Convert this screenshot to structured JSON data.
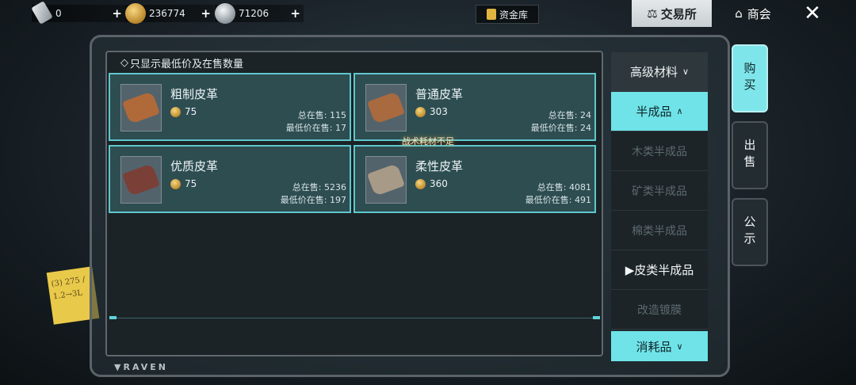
{
  "currencies": [
    {
      "name": "ticket",
      "value": "0"
    },
    {
      "name": "gold",
      "value": "236774"
    },
    {
      "name": "silver",
      "value": "71206"
    }
  ],
  "top": {
    "vault_label": "资金库",
    "exchange_label": "交易所",
    "shop_label": "商会"
  },
  "filter_label": "只显示最低价及在售数量",
  "items": [
    {
      "name": "粗制皮革",
      "price": "75",
      "on_sale": "总在售: 115",
      "lowest": "最低价在售: 17",
      "color": "#b06a3a"
    },
    {
      "name": "普通皮革",
      "price": "303",
      "on_sale": "总在售: 24",
      "lowest": "最低价在售: 24",
      "color": "#a86a3e"
    },
    {
      "name": "优质皮革",
      "price": "75",
      "on_sale": "总在售: 5236",
      "lowest": "最低价在售: 197",
      "color": "#7a4038"
    },
    {
      "name": "柔性皮革",
      "price": "360",
      "on_sale": "总在售: 4081",
      "lowest": "最低价在售: 491",
      "color": "#a79a86"
    }
  ],
  "warning": "战术耗材不足",
  "categories": {
    "head": "高级材料",
    "active": "半成品",
    "subs": [
      "木类半成品",
      "矿类半成品",
      "棉类半成品"
    ],
    "selected": "▶皮类半成品",
    "after": "改造镀膜",
    "foot": "消耗品"
  },
  "tabs": {
    "buy": "购买",
    "sell": "出售",
    "notice": "公示"
  },
  "brand": "RAVEN",
  "note": "(3) 275 / 1.2→3L"
}
